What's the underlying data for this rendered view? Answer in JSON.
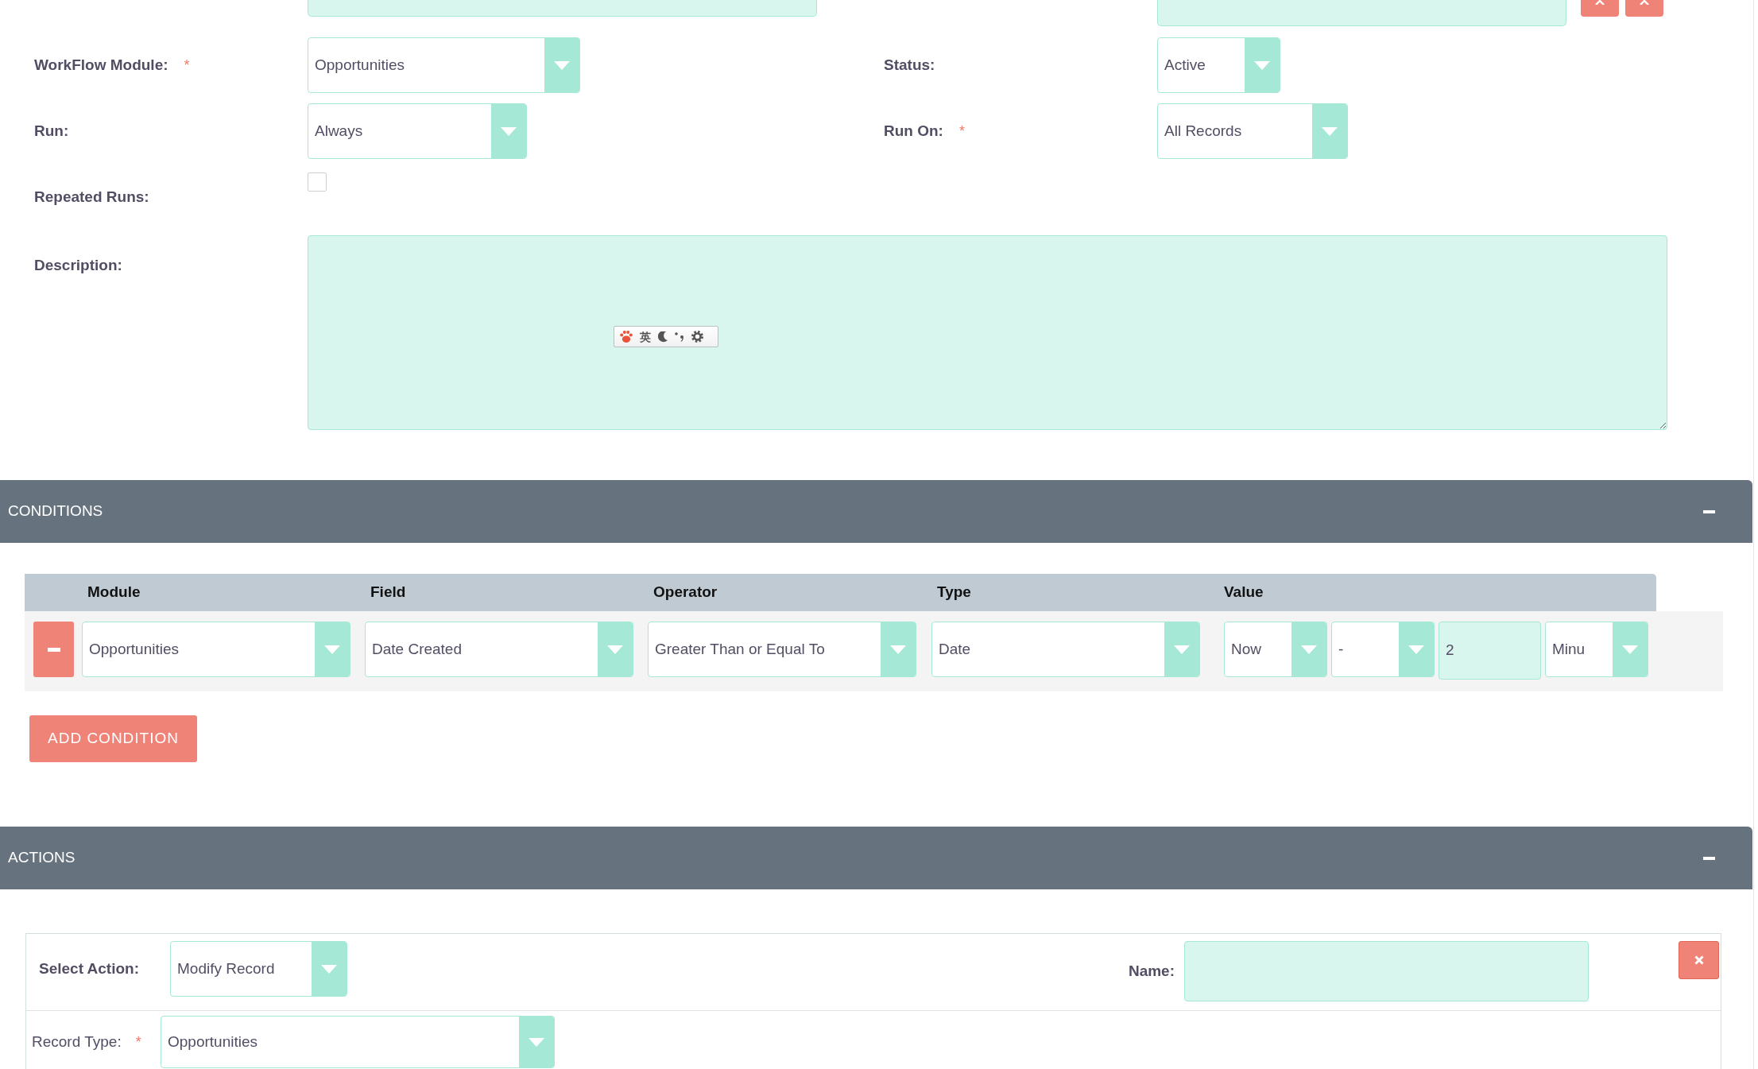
{
  "form": {
    "fields": [
      {
        "label": "WorkFlow Module:",
        "required_mark": "*",
        "kind": "select",
        "value": "Opportunities"
      },
      {
        "label": "Status:",
        "kind": "select",
        "value": "Active"
      },
      {
        "label": "Run:",
        "kind": "select",
        "value": "Always"
      },
      {
        "label": "Run On:",
        "required_mark": "*",
        "kind": "select",
        "value": "All Records"
      },
      {
        "label": "Repeated Runs:",
        "kind": "checkbox",
        "checked": false
      },
      {
        "label": "Description:",
        "kind": "textarea"
      }
    ]
  },
  "ime_toolbar": {
    "mode": "英"
  },
  "conditions": {
    "title": "CONDITIONS",
    "expanded": true,
    "columns": [
      "Module",
      "Field",
      "Operator",
      "Type",
      "Value"
    ],
    "rows": [
      {
        "module": "Opportunities",
        "field": "Date Created",
        "operator": "Greater Than or Equal To",
        "type": "Date",
        "value_parts": [
          {
            "kind": "select",
            "value": "Now"
          },
          {
            "kind": "select",
            "value": "-"
          },
          {
            "kind": "input",
            "value": "2"
          },
          {
            "kind": "select",
            "value": "Minu"
          }
        ]
      }
    ],
    "add_button": "ADD CONDITION"
  },
  "actions": {
    "title": "ACTIONS",
    "expanded": true,
    "items": [
      {
        "select_label": "Select Action:",
        "action": "Modify Record",
        "name_label": "Name:",
        "record_type_label": "Record Type:",
        "required_mark": "*",
        "record_type": "Opportunities"
      }
    ]
  }
}
